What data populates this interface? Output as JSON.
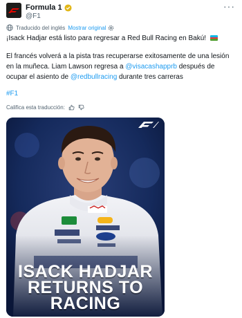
{
  "account": {
    "display_name": "Formula 1",
    "handle": "@F1",
    "verified": true,
    "avatar_icon": "f1-logo-icon",
    "more_icon": "more-dots-icon"
  },
  "translation": {
    "notice": "Traducido del inglés",
    "show_original": "Mostrar original",
    "icon": "globe-icon",
    "settings_icon": "gear-icon"
  },
  "tweet": {
    "line1": "¡Isack Hadjar está listo para regresar a Red Bull Racing en Bakú!",
    "flag": "azerbaijan-flag",
    "para2_a": "El francés volverá a la pista tras recuperarse exitosamente de una lesión en la muñeca. Liam Lawson regresa a ",
    "mention1": "@visacashapprb",
    "para2_b": " después de ocupar el asiento de ",
    "mention2": "@redbullracing",
    "para2_c": " durante tres carreras",
    "hashtag": "#F1"
  },
  "rate_translation": {
    "label": "Califica esta traducción:",
    "thumbs_up_icon": "thumbs-up-icon",
    "thumbs_down_icon": "thumbs-down-icon"
  },
  "media": {
    "tagline_lines": [
      "ISACK HADJAR",
      "RETURNS TO",
      "RACING"
    ],
    "overlay_logo": "f1-logo-icon",
    "colors": {
      "background": "#0f2049",
      "text": "#ffffff",
      "accent": "#e10600"
    }
  }
}
